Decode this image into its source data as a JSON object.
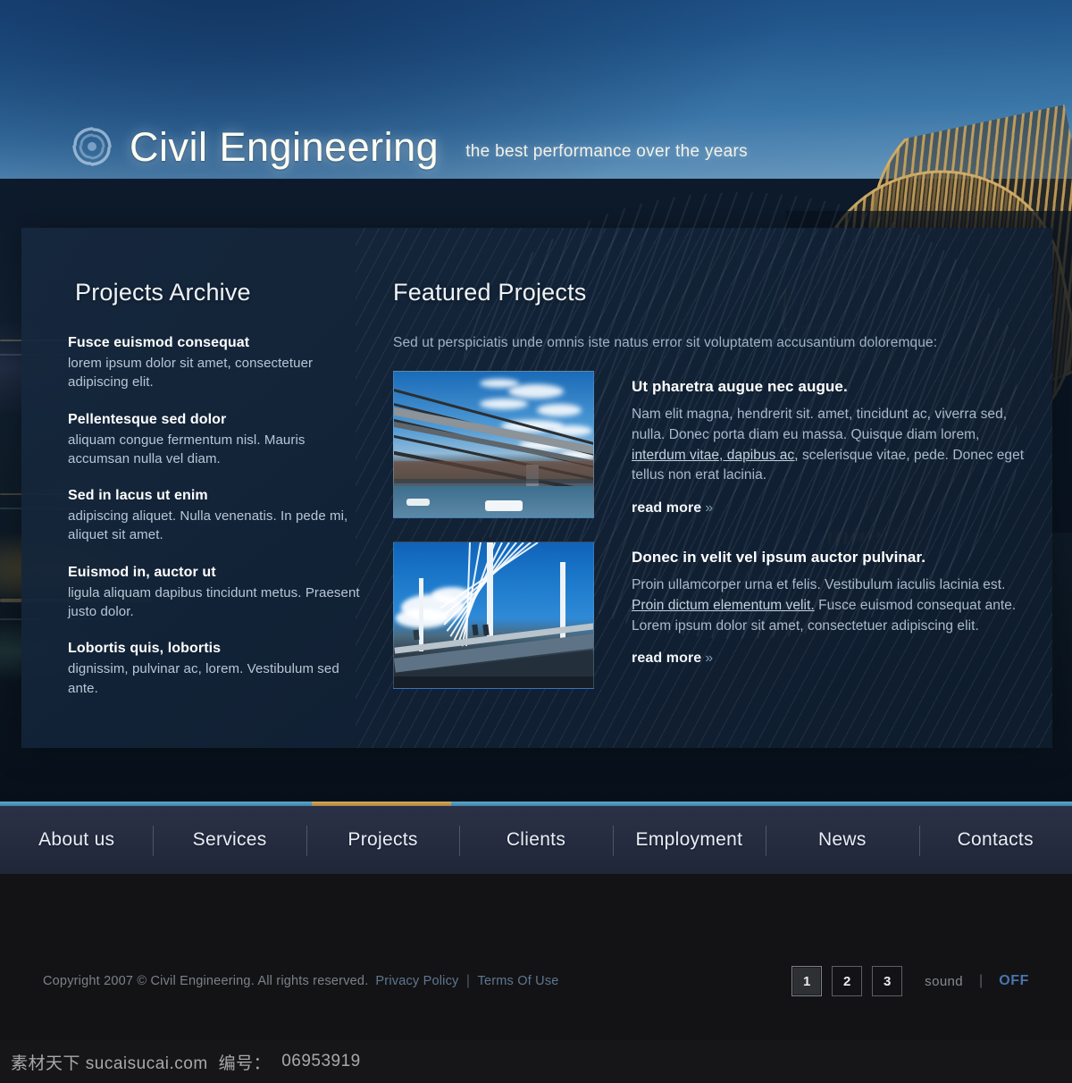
{
  "brand": {
    "logo_icon": "swirl-vortex-icon",
    "name": "Civil Engineering",
    "tagline": "the best performance over the years"
  },
  "colors": {
    "accent_blue": "#5fa6c8",
    "accent_gold": "#d2a85e",
    "panel_bg": "#16283e",
    "nav_bg": "#2a3146",
    "link_blue": "#4a74ad"
  },
  "archive": {
    "title": "Projects Archive",
    "items": [
      {
        "heading": "Fusce euismod consequat",
        "body": "lorem ipsum dolor sit amet, consectetuer adipiscing elit."
      },
      {
        "heading": "Pellentesque sed dolor",
        "body": "aliquam congue fermentum nisl. Mauris accumsan nulla vel diam."
      },
      {
        "heading": "Sed in lacus ut enim",
        "body": "adipiscing aliquet. Nulla venenatis. In pede mi, aliquet sit amet."
      },
      {
        "heading": "Euismod in, auctor ut",
        "body": "ligula aliquam dapibus tincidunt metus. Praesent justo dolor."
      },
      {
        "heading": "Lobortis quis, lobortis",
        "body": "dignissim, pulvinar ac, lorem. Vestibulum sed ante."
      }
    ]
  },
  "featured": {
    "title": "Featured Projects",
    "intro": "Sed ut perspiciatis unde omnis iste natus error sit voluptatem accusantium doloremque:",
    "items": [
      {
        "image_alt": "millennium-bridge-photo",
        "heading": "Ut pharetra augue nec augue.",
        "body_before": "Nam elit magna, hendrerit sit. amet, tincidunt ac, viverra sed, nulla. Donec porta diam eu massa. Quisque diam lorem, ",
        "body_link": "interdum vitae, dapibus ac,",
        "body_after": " scelerisque vitae, pede. Donec eget tellus non erat lacinia.",
        "read_more": "read more",
        "chevron": "»"
      },
      {
        "image_alt": "golden-jubilee-bridge-photo",
        "heading": "Donec in velit vel ipsum auctor pulvinar.",
        "body_before": "Proin ullamcorper urna et felis. Vestibulum iaculis lacinia est. ",
        "body_link": "Proin dictum elementum velit.",
        "body_after": " Fusce euismod consequat ante. Lorem ipsum dolor sit amet, consectetuer adipiscing elit.",
        "read_more": "read more",
        "chevron": "»"
      }
    ]
  },
  "nav": {
    "active_index": 2,
    "items": [
      {
        "label": "About us"
      },
      {
        "label": "Services"
      },
      {
        "label": "Projects"
      },
      {
        "label": "Clients"
      },
      {
        "label": "Employment"
      },
      {
        "label": "News"
      },
      {
        "label": "Contacts"
      }
    ]
  },
  "footer": {
    "copyright": "Copyright 2007 © Civil Engineering. All rights reserved.",
    "privacy_policy": "Privacy Policy",
    "separator": "|",
    "terms": "Terms Of Use",
    "pagination": [
      "1",
      "2",
      "3"
    ],
    "pagination_active": "1",
    "sound_label": "sound",
    "sound_pipe": "|",
    "sound_state": "OFF"
  },
  "watermark": {
    "site": "素材天下  sucaisucai.com",
    "code_label": "编号：",
    "code": "06953919"
  }
}
